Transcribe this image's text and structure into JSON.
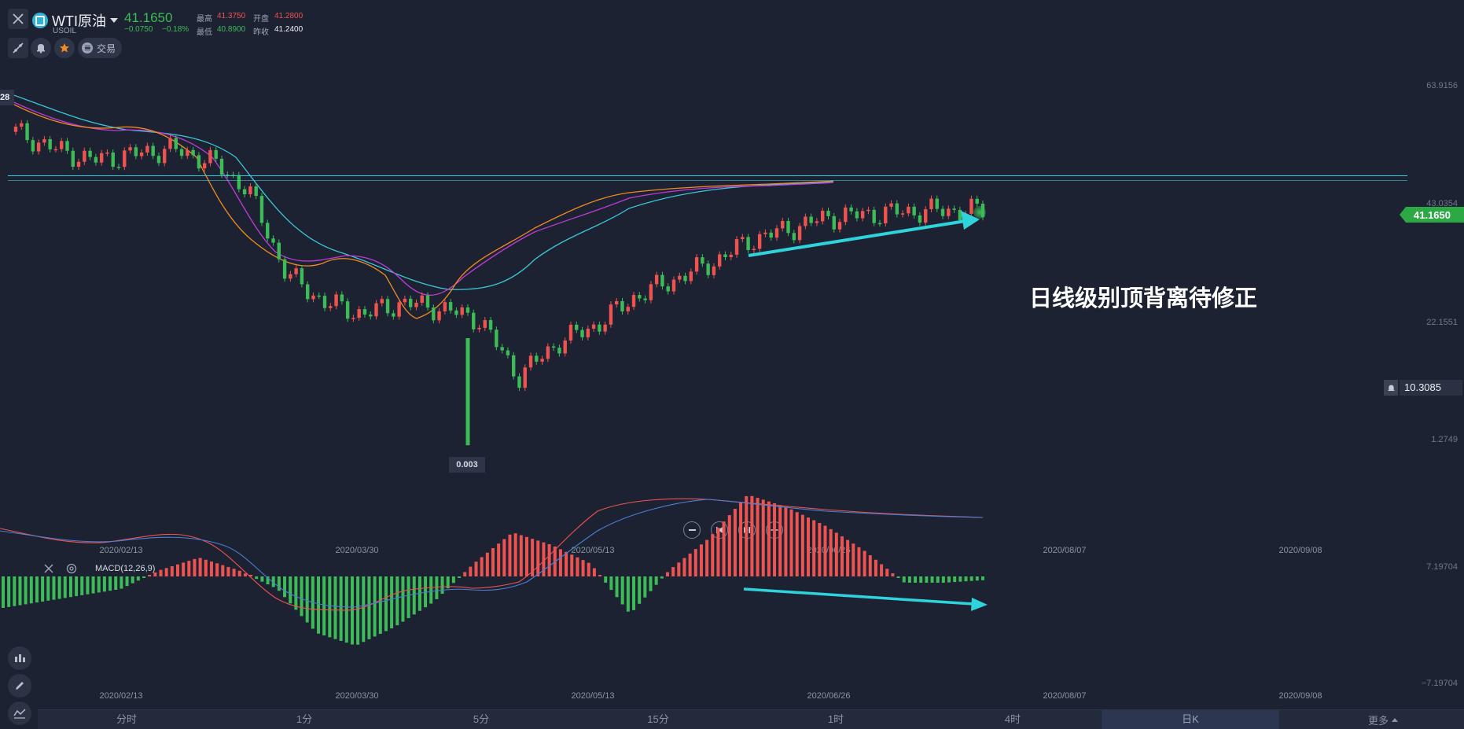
{
  "header": {
    "symbol_name": "WTI原油",
    "symbol_code": "USOIL",
    "last_price": "41.1650",
    "change": "−0.0750",
    "change_pct": "−0.18%",
    "high_label": "最高",
    "high_value": "41.3750",
    "open_label": "开盘",
    "open_value": "41.2800",
    "low_label": "最低",
    "low_value": "40.8900",
    "prev_close_label": "昨收",
    "prev_close_value": "41.2400",
    "trade_label": "交易"
  },
  "price_axis": {
    "ticks": [
      "63.9156",
      "43.0354",
      "22.1551",
      "1.2749"
    ],
    "current_price_tag": "41.1650",
    "alert_price_tag": "10.3085",
    "left_edge_tag": "28"
  },
  "min_marker": "0.003",
  "annotation_text": "日线级别顶背离待修正",
  "x_axis_labels": [
    "2020/02/13",
    "2020/03/30",
    "2020/05/13",
    "2020/06/26",
    "2020/08/07",
    "2020/09/08"
  ],
  "macd": {
    "label": "MACD(12,26,9)",
    "axis_top": "7.19704",
    "axis_bottom": "−7.19704"
  },
  "timeframes": [
    "分时",
    "1分",
    "5分",
    "15分",
    "1时",
    "4时",
    "日K",
    "更多"
  ],
  "active_timeframe": "日K",
  "colors": {
    "up": "#ef5350",
    "down": "#3dbb57",
    "ma_short": "#f08a24",
    "ma_mid": "#c03cd8",
    "ma_long": "#3cc7d6",
    "arrow": "#2fd3dc",
    "bg": "#1c2232"
  },
  "chart_data": {
    "type": "candlestick",
    "title": "",
    "xlabel": "",
    "ylabel": "",
    "ylim": [
      1.2749,
      63.9156
    ],
    "x": [
      "2020/02/13",
      "2020/03/30",
      "2020/05/13",
      "2020/06/26",
      "2020/08/07",
      "2020/09/08"
    ],
    "series": [
      {
        "name": "close (approx.)",
        "values": [
          55,
          52,
          50,
          51,
          52,
          50,
          45,
          30,
          25,
          23,
          25,
          24,
          22,
          12,
          18,
          21,
          26,
          29,
          32,
          36,
          38,
          40,
          40.5,
          41,
          41.2,
          41.165
        ]
      },
      {
        "values": [
          54,
          52,
          51,
          50,
          51,
          49,
          44,
          33,
          28,
          26,
          25,
          24,
          21,
          16,
          17,
          20,
          25,
          28,
          31,
          35,
          37,
          39,
          40,
          40.5,
          40.9,
          41.0
        ]
      },
      {
        "values": [
          56,
          53,
          52,
          50,
          50,
          48,
          43,
          34,
          30,
          28,
          26,
          24,
          22,
          18,
          17,
          18,
          22,
          26,
          29,
          33,
          35,
          37,
          38.5,
          39.5,
          40.3,
          40.8
        ]
      },
      {
        "values": [
          57,
          55,
          53,
          52,
          51,
          49,
          47,
          41,
          35,
          30,
          27,
          25,
          22,
          21,
          20,
          19,
          19,
          21,
          25,
          29,
          32,
          35,
          37,
          38.5,
          39.5,
          40.2
        ]
      }
    ],
    "macd_histogram": [
      -2.5,
      -2.0,
      -1.5,
      -1.0,
      0.5,
      1.5,
      0.5,
      -1.0,
      -4.5,
      -5.5,
      -4.0,
      -2.0,
      1.0,
      3.5,
      2.5,
      1.0,
      -3.0,
      0.5,
      3.0,
      6.5,
      5.5,
      4.0,
      2.0,
      -0.5,
      -0.5,
      -0.3
    ],
    "min_value": 0.003
  }
}
